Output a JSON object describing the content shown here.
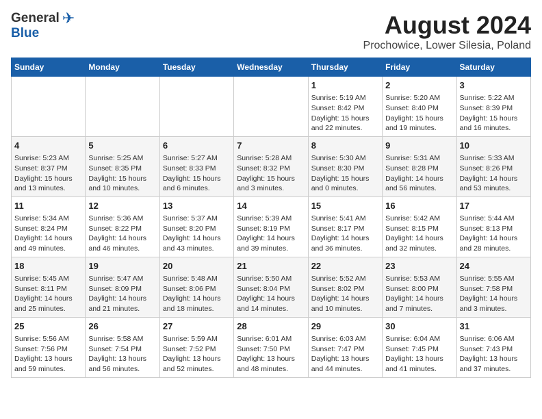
{
  "header": {
    "logo_general": "General",
    "logo_blue": "Blue",
    "month_year": "August 2024",
    "location": "Prochowice, Lower Silesia, Poland"
  },
  "weekdays": [
    "Sunday",
    "Monday",
    "Tuesday",
    "Wednesday",
    "Thursday",
    "Friday",
    "Saturday"
  ],
  "weeks": [
    [
      {
        "day": "",
        "content": ""
      },
      {
        "day": "",
        "content": ""
      },
      {
        "day": "",
        "content": ""
      },
      {
        "day": "",
        "content": ""
      },
      {
        "day": "1",
        "content": "Sunrise: 5:19 AM\nSunset: 8:42 PM\nDaylight: 15 hours\nand 22 minutes."
      },
      {
        "day": "2",
        "content": "Sunrise: 5:20 AM\nSunset: 8:40 PM\nDaylight: 15 hours\nand 19 minutes."
      },
      {
        "day": "3",
        "content": "Sunrise: 5:22 AM\nSunset: 8:39 PM\nDaylight: 15 hours\nand 16 minutes."
      }
    ],
    [
      {
        "day": "4",
        "content": "Sunrise: 5:23 AM\nSunset: 8:37 PM\nDaylight: 15 hours\nand 13 minutes."
      },
      {
        "day": "5",
        "content": "Sunrise: 5:25 AM\nSunset: 8:35 PM\nDaylight: 15 hours\nand 10 minutes."
      },
      {
        "day": "6",
        "content": "Sunrise: 5:27 AM\nSunset: 8:33 PM\nDaylight: 15 hours\nand 6 minutes."
      },
      {
        "day": "7",
        "content": "Sunrise: 5:28 AM\nSunset: 8:32 PM\nDaylight: 15 hours\nand 3 minutes."
      },
      {
        "day": "8",
        "content": "Sunrise: 5:30 AM\nSunset: 8:30 PM\nDaylight: 15 hours\nand 0 minutes."
      },
      {
        "day": "9",
        "content": "Sunrise: 5:31 AM\nSunset: 8:28 PM\nDaylight: 14 hours\nand 56 minutes."
      },
      {
        "day": "10",
        "content": "Sunrise: 5:33 AM\nSunset: 8:26 PM\nDaylight: 14 hours\nand 53 minutes."
      }
    ],
    [
      {
        "day": "11",
        "content": "Sunrise: 5:34 AM\nSunset: 8:24 PM\nDaylight: 14 hours\nand 49 minutes."
      },
      {
        "day": "12",
        "content": "Sunrise: 5:36 AM\nSunset: 8:22 PM\nDaylight: 14 hours\nand 46 minutes."
      },
      {
        "day": "13",
        "content": "Sunrise: 5:37 AM\nSunset: 8:20 PM\nDaylight: 14 hours\nand 43 minutes."
      },
      {
        "day": "14",
        "content": "Sunrise: 5:39 AM\nSunset: 8:19 PM\nDaylight: 14 hours\nand 39 minutes."
      },
      {
        "day": "15",
        "content": "Sunrise: 5:41 AM\nSunset: 8:17 PM\nDaylight: 14 hours\nand 36 minutes."
      },
      {
        "day": "16",
        "content": "Sunrise: 5:42 AM\nSunset: 8:15 PM\nDaylight: 14 hours\nand 32 minutes."
      },
      {
        "day": "17",
        "content": "Sunrise: 5:44 AM\nSunset: 8:13 PM\nDaylight: 14 hours\nand 28 minutes."
      }
    ],
    [
      {
        "day": "18",
        "content": "Sunrise: 5:45 AM\nSunset: 8:11 PM\nDaylight: 14 hours\nand 25 minutes."
      },
      {
        "day": "19",
        "content": "Sunrise: 5:47 AM\nSunset: 8:09 PM\nDaylight: 14 hours\nand 21 minutes."
      },
      {
        "day": "20",
        "content": "Sunrise: 5:48 AM\nSunset: 8:06 PM\nDaylight: 14 hours\nand 18 minutes."
      },
      {
        "day": "21",
        "content": "Sunrise: 5:50 AM\nSunset: 8:04 PM\nDaylight: 14 hours\nand 14 minutes."
      },
      {
        "day": "22",
        "content": "Sunrise: 5:52 AM\nSunset: 8:02 PM\nDaylight: 14 hours\nand 10 minutes."
      },
      {
        "day": "23",
        "content": "Sunrise: 5:53 AM\nSunset: 8:00 PM\nDaylight: 14 hours\nand 7 minutes."
      },
      {
        "day": "24",
        "content": "Sunrise: 5:55 AM\nSunset: 7:58 PM\nDaylight: 14 hours\nand 3 minutes."
      }
    ],
    [
      {
        "day": "25",
        "content": "Sunrise: 5:56 AM\nSunset: 7:56 PM\nDaylight: 13 hours\nand 59 minutes."
      },
      {
        "day": "26",
        "content": "Sunrise: 5:58 AM\nSunset: 7:54 PM\nDaylight: 13 hours\nand 56 minutes."
      },
      {
        "day": "27",
        "content": "Sunrise: 5:59 AM\nSunset: 7:52 PM\nDaylight: 13 hours\nand 52 minutes."
      },
      {
        "day": "28",
        "content": "Sunrise: 6:01 AM\nSunset: 7:50 PM\nDaylight: 13 hours\nand 48 minutes."
      },
      {
        "day": "29",
        "content": "Sunrise: 6:03 AM\nSunset: 7:47 PM\nDaylight: 13 hours\nand 44 minutes."
      },
      {
        "day": "30",
        "content": "Sunrise: 6:04 AM\nSunset: 7:45 PM\nDaylight: 13 hours\nand 41 minutes."
      },
      {
        "day": "31",
        "content": "Sunrise: 6:06 AM\nSunset: 7:43 PM\nDaylight: 13 hours\nand 37 minutes."
      }
    ]
  ]
}
